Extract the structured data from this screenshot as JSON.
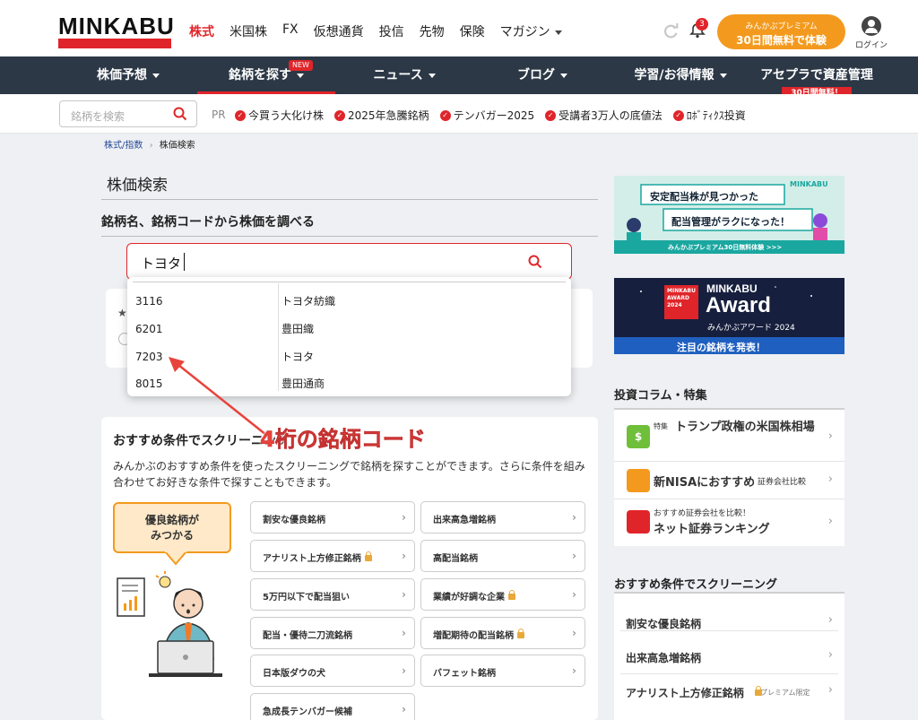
{
  "header": {
    "logo_text": "MINKABU",
    "nav": [
      "株式",
      "米国株",
      "FX",
      "仮想通貨",
      "投信",
      "先物",
      "保険",
      "マガジン"
    ],
    "notification_count": "3",
    "premium_line1": "みんかぶプレミアム",
    "premium_line2": "30日間無料で体験",
    "login_label": "ログイン"
  },
  "mainnav": {
    "items": [
      "株価予想",
      "銘柄を探す",
      "ニュース",
      "ブログ",
      "学習/お得情報",
      "アセプラで資産管理"
    ],
    "new_badge": "NEW",
    "free_badge": "30日間無料！"
  },
  "subbar": {
    "search_placeholder": "銘柄を検索",
    "pr": "PR",
    "tags": [
      "今買う大化け株",
      "2025年急騰銘柄",
      "テンバガー2025",
      "受講者3万人の底値法",
      "ﾛﾎﾞﾃｨｸｽ投資"
    ]
  },
  "breadcrumb": {
    "home": "株式/指数",
    "sep": "›",
    "current": "株価検索"
  },
  "page": {
    "title": "株価検索",
    "subtitle": "銘柄名、銘柄コードから株価を調べる",
    "search_value": "トヨタ"
  },
  "dropdown": [
    {
      "code": "3116",
      "name": "トヨタ紡織"
    },
    {
      "code": "6201",
      "name": "豊田織"
    },
    {
      "code": "7203",
      "name": "トヨタ"
    },
    {
      "code": "8015",
      "name": "豊田通商"
    }
  ],
  "annotation": "4桁の銘柄コード",
  "recommend": {
    "title": "おすすめ条件でスクリーニング",
    "desc": "みんかぶのおすすめ条件を使ったスクリーニングで銘柄を探すことができます。さらに条件を組み合わせてお好きな条件で探すこともできます。",
    "bubble_line1": "優良銘柄が",
    "bubble_line2": "みつかる",
    "buttons": [
      {
        "label": "割安な優良銘柄",
        "lock": false
      },
      {
        "label": "出来高急増銘柄",
        "lock": false
      },
      {
        "label": "アナリスト上方修正銘柄",
        "lock": true
      },
      {
        "label": "高配当銘柄",
        "lock": false
      },
      {
        "label": "5万円以下で配当狙い",
        "lock": false
      },
      {
        "label": "業績が好調な企業",
        "lock": true
      },
      {
        "label": "配当・優待二刀流銘柄",
        "lock": false
      },
      {
        "label": "増配期待の配当銘柄",
        "lock": true
      },
      {
        "label": "日本版ダウの犬",
        "lock": false
      },
      {
        "label": "バフェット銘柄",
        "lock": false
      },
      {
        "label": "急成長テンバガー候補",
        "lock": false
      }
    ]
  },
  "sidebar": {
    "banner1": {
      "brand": "MINKABU",
      "line1": "安定配当株が見つかった",
      "line2": "配当管理がラクになった！",
      "footer": "みんかぶプレミアム30日無料体験 >>>"
    },
    "banner2": {
      "badge_line1": "MINKABU",
      "badge_line2": "AWARD",
      "badge_line3": "2024",
      "title_small": "MINKABU",
      "title_big": "Award",
      "sub": "みんかぶアワード 2024",
      "footer": "注目の銘柄を発表！"
    },
    "column_title": "投資コラム・特集",
    "columns": [
      {
        "tag": "特集",
        "text": "トランプ政権の米国株相場"
      },
      {
        "tag": "",
        "text": "新NISAにおすすめ",
        "sub": "証券会社比較"
      },
      {
        "tag": "おすすめ証券会社を比較！",
        "text": "ネット証券ランキング"
      }
    ],
    "screen_title": "おすすめ条件でスクリーニング",
    "screen_items": [
      {
        "text": "割安な優良銘柄",
        "note": ""
      },
      {
        "text": "出来高急増銘柄",
        "note": ""
      },
      {
        "text": "アナリスト上方修正銘柄",
        "note": "プレミアム限定"
      }
    ]
  },
  "colors": {
    "brand_red": "#e0252a",
    "nav_dark": "#2c3846",
    "premium_orange": "#f39a1e"
  }
}
